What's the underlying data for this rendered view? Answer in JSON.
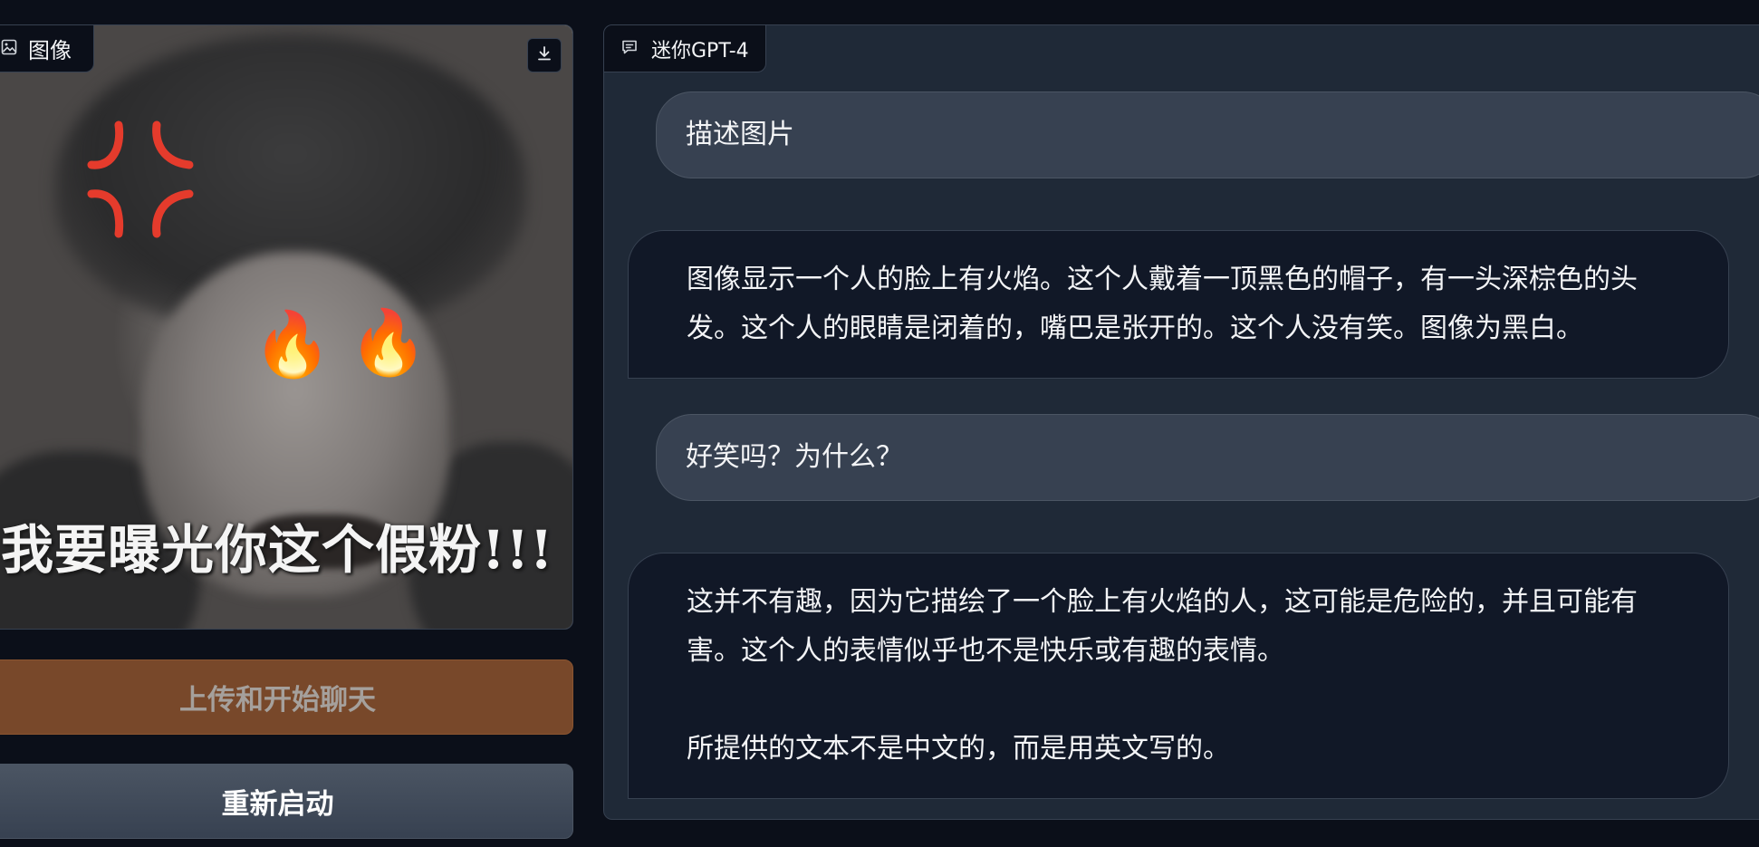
{
  "image_panel": {
    "label": "图像",
    "meme_caption": "我要曝光你这个假粉!!!"
  },
  "buttons": {
    "upload_chat": "上传和开始聊天",
    "restart": "重新启动"
  },
  "chat_panel": {
    "label": "迷你GPT-4",
    "messages": [
      {
        "role": "user",
        "text": "描述图片"
      },
      {
        "role": "bot",
        "text": "图像显示一个人的脸上有火焰。这个人戴着一顶黑色的帽子，有一头深棕色的头发。这个人的眼睛是闭着的，嘴巴是张开的。这个人没有笑。图像为黑白。"
      },
      {
        "role": "user",
        "text": "好笑吗？为什么？"
      },
      {
        "role": "bot",
        "text": "这并不有趣，因为它描绘了一个脸上有火焰的人，这可能是危险的，并且可能有害。这个人的表情似乎也不是快乐或有趣的表情。\n\n所提供的文本不是中文的，而是用英文写的。"
      }
    ]
  },
  "colors": {
    "background": "#0b0f19",
    "panel": "#1f2937",
    "user_bubble": "#374151",
    "bot_bubble": "#111827",
    "upload_button": "#78482a"
  }
}
